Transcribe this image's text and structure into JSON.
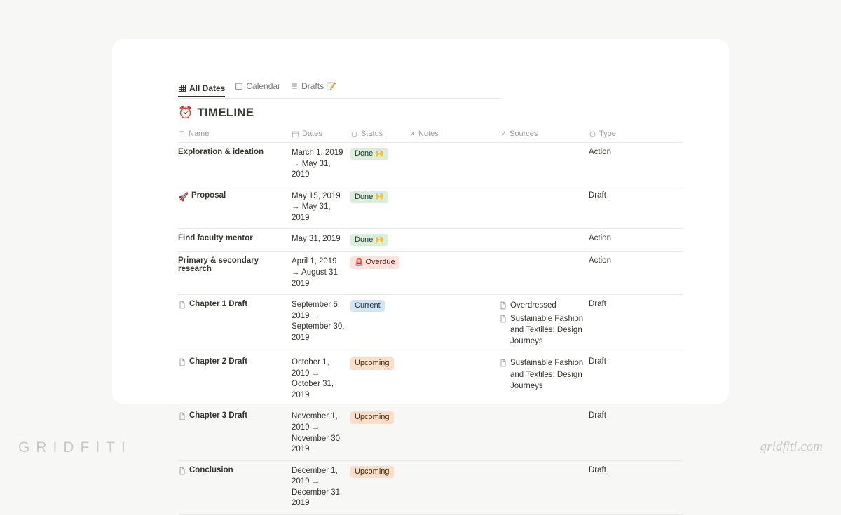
{
  "tabs": [
    {
      "label": "All Dates",
      "icon": "table",
      "active": true
    },
    {
      "label": "Calendar",
      "icon": "calendar",
      "active": false
    },
    {
      "label": "Drafts",
      "icon": "list",
      "active": false,
      "trailingEmoji": "📝"
    }
  ],
  "title": {
    "emoji": "⏰",
    "text": "TIMELINE"
  },
  "columns": {
    "name": "Name",
    "dates": "Dates",
    "status": "Status",
    "notes": "Notes",
    "sources": "Sources",
    "type": "Type"
  },
  "status_styles": {
    "Done": {
      "class": "done",
      "emoji": "🙌"
    },
    "Overdue": {
      "class": "overdue",
      "emoji": "🚨"
    },
    "Current": {
      "class": "current",
      "emoji": ""
    },
    "Upcoming": {
      "class": "upcoming",
      "emoji": ""
    }
  },
  "rows": [
    {
      "icon": "",
      "name": "Exploration & ideation",
      "dates": "March 1, 2019 → May 31, 2019",
      "status": "Done",
      "notes": "",
      "sources": [],
      "type": "Action"
    },
    {
      "icon": "🚀",
      "name": "Proposal",
      "dates": "May 15, 2019 → May 31, 2019",
      "status": "Done",
      "notes": "",
      "sources": [],
      "type": "Draft"
    },
    {
      "icon": "",
      "name": "Find faculty mentor",
      "dates": "May 31, 2019",
      "status": "Done",
      "notes": "",
      "sources": [],
      "type": "Action"
    },
    {
      "icon": "",
      "name": "Primary & secondary research",
      "dates": "April 1, 2019 → August 31, 2019",
      "status": "Overdue",
      "notes": "",
      "sources": [],
      "type": "Action"
    },
    {
      "icon": "page",
      "name": "Chapter 1 Draft",
      "dates": "September 5, 2019 → September 30, 2019",
      "status": "Current",
      "notes": "",
      "sources": [
        "Overdressed",
        "Sustainable Fashion and Textiles: Design Journeys"
      ],
      "type": "Draft"
    },
    {
      "icon": "page",
      "name": "Chapter 2 Draft",
      "dates": "October 1, 2019 → October 31, 2019",
      "status": "Upcoming",
      "notes": "",
      "sources": [
        "Sustainable Fashion and Textiles: Design Journeys"
      ],
      "type": "Draft"
    },
    {
      "icon": "page",
      "name": "Chapter 3 Draft",
      "dates": "November 1, 2019 → November 30, 2019",
      "status": "Upcoming",
      "notes": "",
      "sources": [],
      "type": "Draft"
    },
    {
      "icon": "page",
      "name": "Conclusion",
      "dates": "December 1, 2019 → December 31, 2019",
      "status": "Upcoming",
      "notes": "",
      "sources": [],
      "type": "Draft"
    }
  ],
  "footer": {
    "brand": "GRIDFITI",
    "url": "gridfiti.com"
  }
}
